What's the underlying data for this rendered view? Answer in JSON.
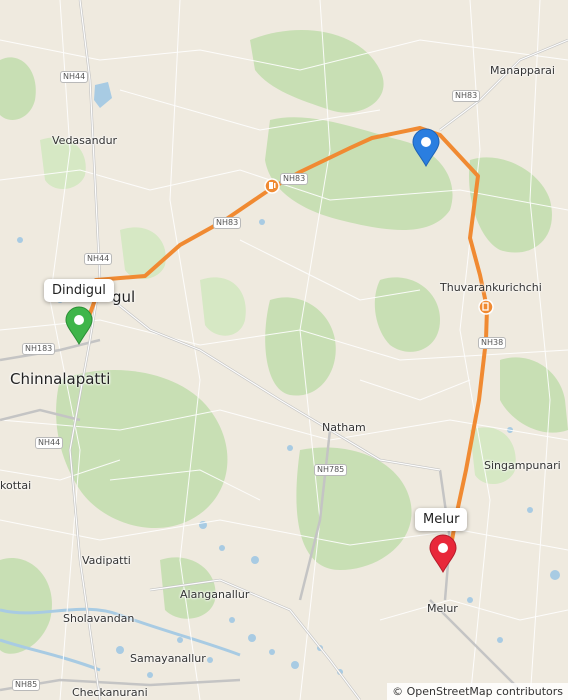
{
  "places": {
    "manapparai": "Manapparai",
    "vedasandur": "Vedasandur",
    "dindigul_partial": "gul",
    "chinnalapatti": "Chinnalapatti",
    "thuvarankurichchi": "Thuvarankurichchi",
    "natham": "Natham",
    "singampunari": "Singampunari",
    "kottai_partial": "kottai",
    "vadipatti": "Vadipatti",
    "alanganallur": "Alanganallur",
    "sholavandan": "Sholavandan",
    "samayanallur": "Samayanallur",
    "checkanurani": "Checkanurani",
    "melur": "Melur"
  },
  "road_shields": {
    "nh44_top": "NH44",
    "nh83_top": "NH83",
    "nh83_route": "NH83",
    "nh83_mid": "NH83",
    "nh44_mid": "NH44",
    "nh183": "NH183",
    "nh38": "NH38",
    "nh44_low": "NH44",
    "nh785": "NH785",
    "nh85": "NH85"
  },
  "callouts": {
    "start": "Dindigul",
    "end": "Melur"
  },
  "markers": {
    "start_color": "#3fb54a",
    "waypoint_color": "#2a7ee0",
    "end_color": "#e8283a",
    "route_color": "#f08a32",
    "fuel_icon": "fuel-icon"
  },
  "attribution": "© OpenStreetMap contributors"
}
